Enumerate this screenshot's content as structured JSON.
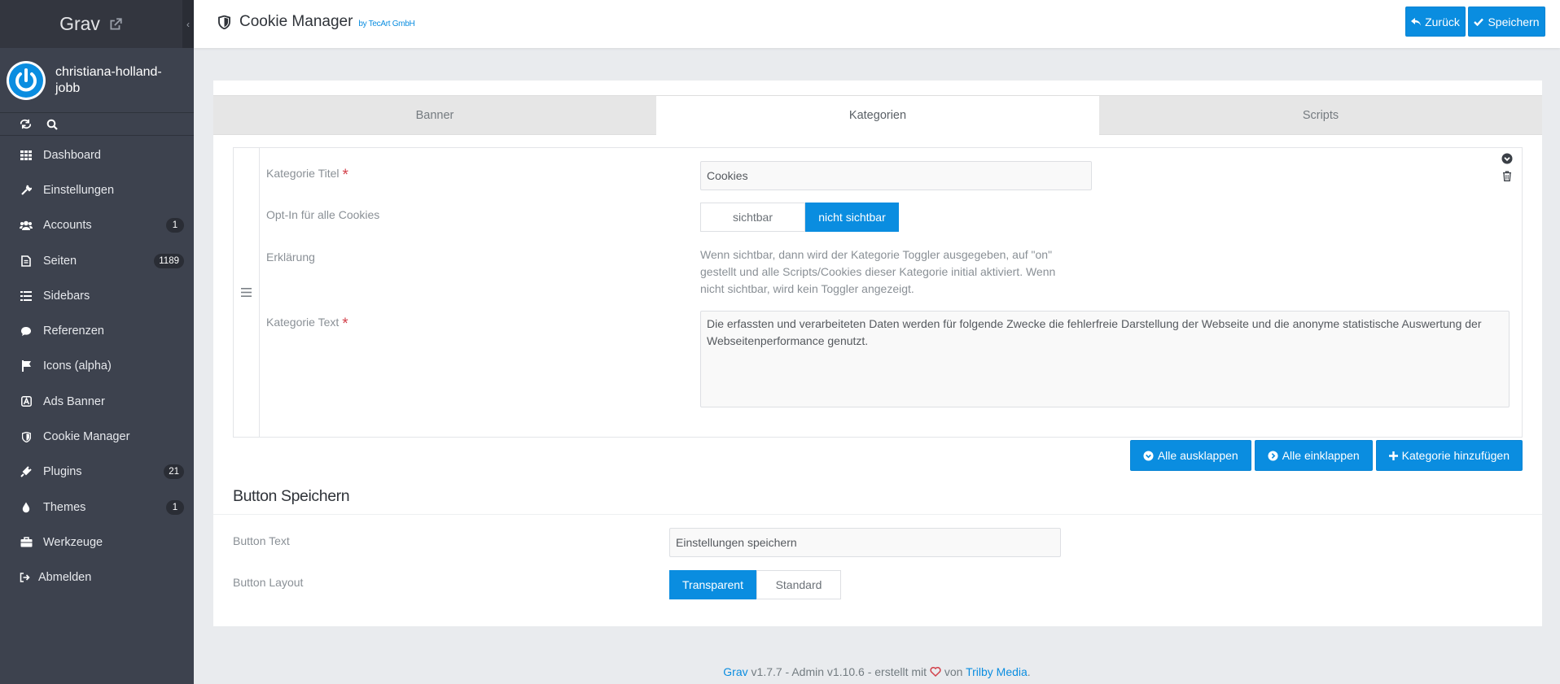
{
  "sidebar": {
    "brand": "Grav",
    "username": "christiana-holland-jobb",
    "items": [
      {
        "label": "Dashboard",
        "icon": "grid-icon"
      },
      {
        "label": "Einstellungen",
        "icon": "wrench-icon"
      },
      {
        "label": "Accounts",
        "icon": "users-icon",
        "badge": "1"
      },
      {
        "label": "Seiten",
        "icon": "file-icon",
        "badge": "1189"
      },
      {
        "label": "Sidebars",
        "icon": "list-icon"
      },
      {
        "label": "Referenzen",
        "icon": "comment-icon"
      },
      {
        "label": "Icons (alpha)",
        "icon": "flag-icon"
      },
      {
        "label": "Ads Banner",
        "icon": "font-icon"
      },
      {
        "label": "Cookie Manager",
        "icon": "shield-icon"
      },
      {
        "label": "Plugins",
        "icon": "plug-icon",
        "badge": "21"
      },
      {
        "label": "Themes",
        "icon": "tint-icon",
        "badge": "1"
      },
      {
        "label": "Werkzeuge",
        "icon": "briefcase-icon"
      },
      {
        "label": "Abmelden",
        "icon": "sign-out-icon"
      }
    ]
  },
  "header": {
    "title": "Cookie Manager",
    "byline": "by TecArt GmbH",
    "back_label": "Zurück",
    "save_label": "Speichern"
  },
  "tabs": [
    "Banner",
    "Kategorien",
    "Scripts"
  ],
  "category": {
    "title_label": "Kategorie Titel",
    "title_value": "Cookies",
    "optin_label": "Opt-In für alle Cookies",
    "optin_options": [
      "sichtbar",
      "nicht sichtbar"
    ],
    "explain_label": "Erklärung",
    "explain_text": "Wenn sichtbar, dann wird der Kategorie Toggler ausgegeben, auf \"on\" gestellt und alle Scripts/Cookies dieser Kategorie initial aktiviert. Wenn nicht sichtbar, wird kein Toggler angezeigt.",
    "text_label": "Kategorie Text",
    "text_value": "Die erfassten und verarbeiteten Daten werden für folgende Zwecke die fehlerfreie Darstellung der Webseite und die anonyme statistische Auswertung der Webseitenperformance genutzt."
  },
  "collection_actions": {
    "expand": "Alle ausklappen",
    "collapse": "Alle einklappen",
    "add": "Kategorie hinzufügen"
  },
  "button_section": {
    "title": "Button Speichern",
    "text_label": "Button Text",
    "text_value": "Einstellungen speichern",
    "layout_label": "Button Layout",
    "layout_options": [
      "Transparent",
      "Standard"
    ]
  },
  "footer": {
    "grav": "Grav",
    "middle": " v1.7.7 - Admin v1.10.6 - erstellt mit ",
    "von": " von ",
    "trilby": "Trilby Media",
    "end": "."
  },
  "colors": {
    "accent": "#0a8de0",
    "sidebar": "#3d424e",
    "required": "#d2404a"
  }
}
